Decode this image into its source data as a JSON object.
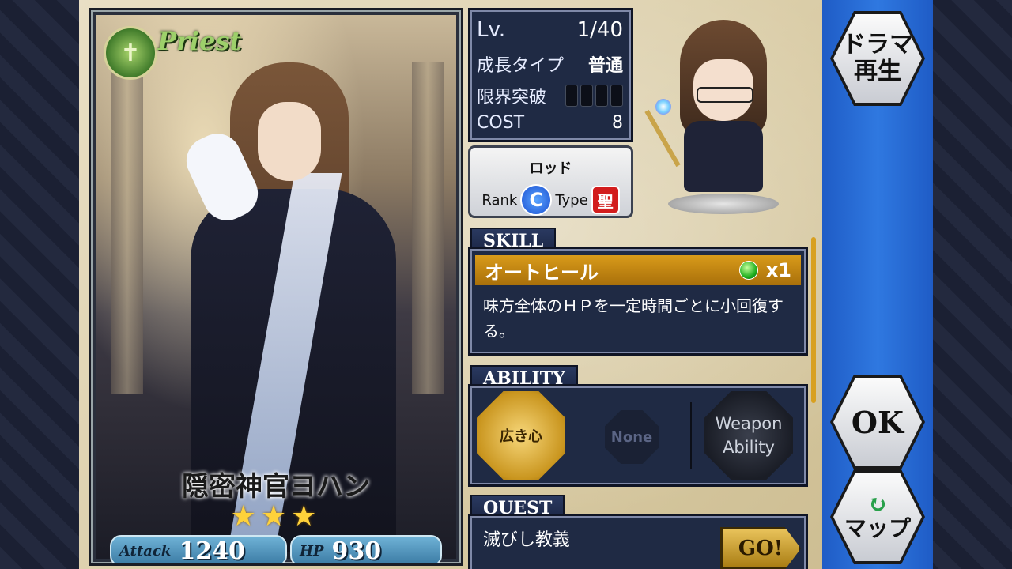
{
  "card": {
    "class_label": "Priest",
    "name": "隠密神官ヨハン",
    "stars": "★★★",
    "attack_label": "Attack",
    "attack_value": "1240",
    "hp_label": "HP",
    "hp_value": "930"
  },
  "stats": {
    "level_label": "Lv.",
    "level_value": "1/40",
    "growth_label": "成長タイプ",
    "growth_value": "普通",
    "limit_label": "限界突破",
    "cost_label": "COST",
    "cost_value": "8"
  },
  "weapon": {
    "name": "ロッド",
    "rank_label": "Rank",
    "rank_value": "C",
    "type_label": "Type",
    "type_value": "聖"
  },
  "skill": {
    "tab": "SKILL",
    "name": "オートヒール",
    "count": "x1",
    "description": "味方全体のＨＰを一定時間ごとに小回復する。"
  },
  "ability": {
    "tab": "ABILITY",
    "main": "広き心",
    "none": "None",
    "weapon_line1": "Weapon",
    "weapon_line2": "Ability"
  },
  "quest": {
    "tab": "QUEST",
    "name": "滅びし教義",
    "go": "GO!"
  },
  "side": {
    "drama_line1": "ドラマ",
    "drama_line2": "再生",
    "ok": "OK",
    "map": "マップ"
  },
  "colors": {
    "panel_bg": "#1f2a44",
    "skill_bar": "#d99b1a",
    "side_blue": "#2f78e0"
  }
}
